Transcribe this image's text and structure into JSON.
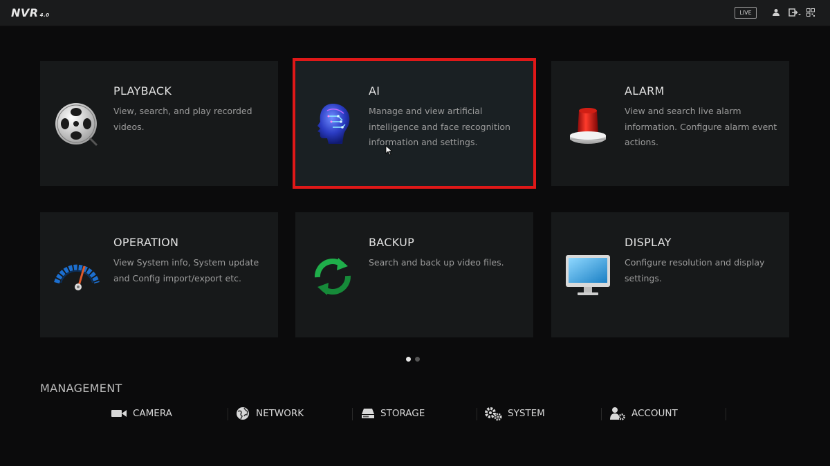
{
  "header": {
    "logo_text": "NVR",
    "logo_version": "4.0",
    "live_label": "LIVE",
    "icons": [
      "user-icon",
      "logout-icon",
      "qr-code-icon"
    ]
  },
  "tiles": [
    {
      "title": "PLAYBACK",
      "desc": "View, search, and play recorded videos.",
      "icon": "film-reel-icon"
    },
    {
      "title": "AI",
      "desc": "Manage and view artificial intelligence and face recognition information and settings.",
      "icon": "ai-head-icon",
      "selected": true
    },
    {
      "title": "ALARM",
      "desc": "View and search live alarm information. Configure alarm event actions.",
      "icon": "alarm-light-icon"
    },
    {
      "title": "OPERATION",
      "desc": "View System info, System update and Config import/export etc.",
      "icon": "gauge-icon"
    },
    {
      "title": "BACKUP",
      "desc": "Search and back up video files.",
      "icon": "refresh-icon"
    },
    {
      "title": "DISPLAY",
      "desc": "Configure resolution and display settings.",
      "icon": "monitor-icon"
    }
  ],
  "pager": {
    "pages": 2,
    "active": 1
  },
  "management": {
    "title": "MANAGEMENT",
    "items": [
      {
        "label": "CAMERA",
        "icon": "camera-icon"
      },
      {
        "label": "NETWORK",
        "icon": "globe-icon"
      },
      {
        "label": "STORAGE",
        "icon": "hard-drive-icon"
      },
      {
        "label": "SYSTEM",
        "icon": "gears-icon"
      },
      {
        "label": "ACCOUNT",
        "icon": "user-gear-icon"
      }
    ]
  },
  "colors": {
    "selection": "#e01818",
    "background": "#0b0b0c",
    "tile": "#17191a"
  }
}
